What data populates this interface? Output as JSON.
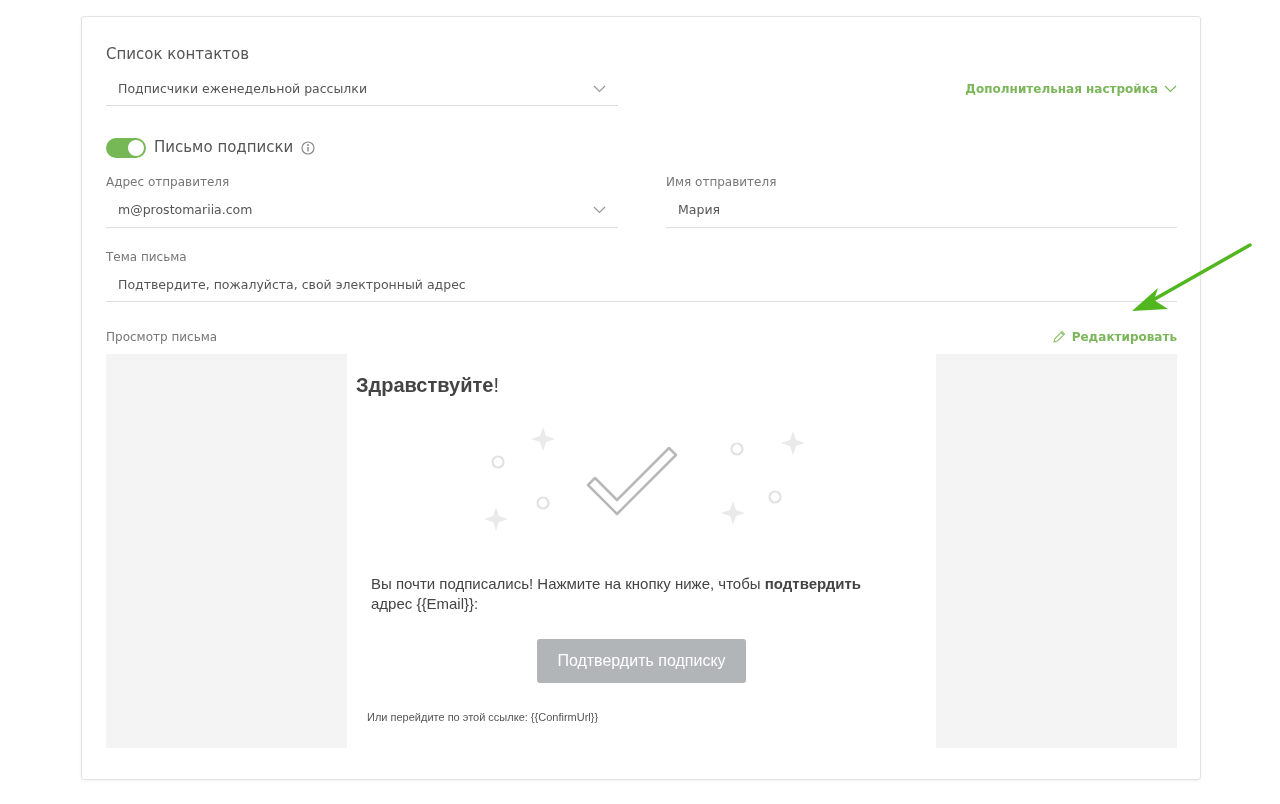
{
  "contact_list": {
    "label": "Список контактов",
    "value": "Подписчики еженедельной рассылки"
  },
  "advanced_settings": {
    "label": "Дополнительная настройка",
    "expanded": false
  },
  "subscription_email": {
    "label": "Письмо подписки",
    "on": true
  },
  "sender_address": {
    "label": "Адрес отправителя",
    "value": "m@prostomariia.com"
  },
  "sender_name": {
    "label": "Имя отправителя",
    "value": "Мария"
  },
  "subject": {
    "label": "Тема письма",
    "value": "Подтвердите, пожалуйста, свой электронный адрес"
  },
  "preview": {
    "label": "Просмотр письма",
    "edit_link": "Редактировать",
    "greeting": "**Здравствуйте**!",
    "body": "Вы почти подписались! Нажмите на кнопку ниже, чтобы **подтвердить** адрес {{Email}}:",
    "button": "Подтвердить подписку",
    "footer": "Или перейдите по этой ссылке: {{ConfirmUrl}}"
  }
}
